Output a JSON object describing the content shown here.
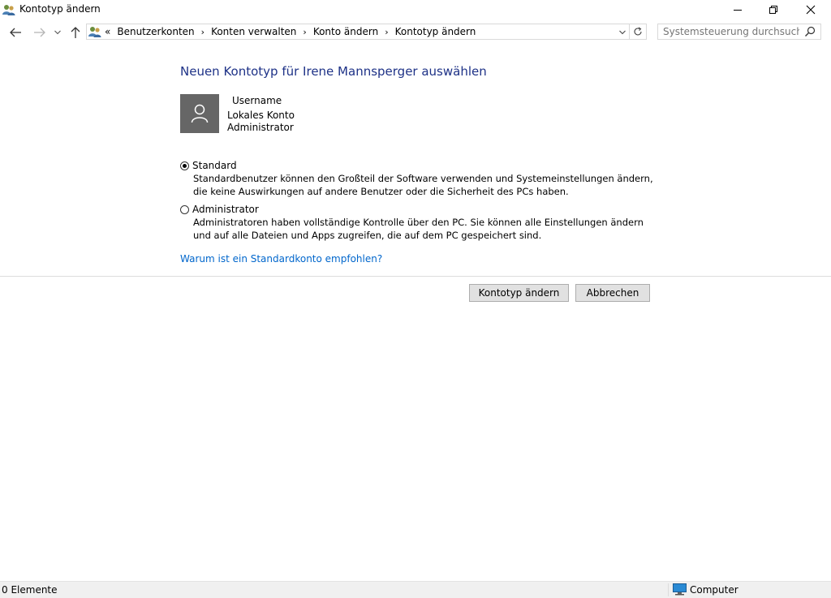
{
  "window": {
    "title": "Kontotyp ändern"
  },
  "address": {
    "overflow": "«",
    "crumbs": [
      "Benutzerkonten",
      "Konten verwalten",
      "Konto ändern",
      "Kontotyp ändern"
    ]
  },
  "search": {
    "placeholder": "Systemsteuerung durchsuchen"
  },
  "main": {
    "heading": "Neuen Kontotyp für Irene Mannsperger auswählen",
    "account": {
      "name": "Username",
      "type": "Lokales Konto",
      "role": "Administrator"
    },
    "options": [
      {
        "label": "Standard",
        "selected": true,
        "description": "Standardbenutzer können den Großteil der Software verwenden und Systemeinstellungen ändern, die keine Auswirkungen auf andere Benutzer oder die Sicherheit des PCs haben."
      },
      {
        "label": "Administrator",
        "selected": false,
        "description": "Administratoren haben vollständige Kontrolle über den PC. Sie können alle Einstellungen ändern und auf alle Dateien und Apps zugreifen, die auf dem PC gespeichert sind."
      }
    ],
    "help_link": "Warum ist ein Standardkonto empfohlen?",
    "confirm_button": "Kontotyp ändern",
    "cancel_button": "Abbrechen"
  },
  "status": {
    "items_count": "0 Elemente",
    "zone": "Computer"
  },
  "colors": {
    "heading": "#1e3287",
    "link": "#0066cc",
    "avatar_bg": "#666666"
  }
}
